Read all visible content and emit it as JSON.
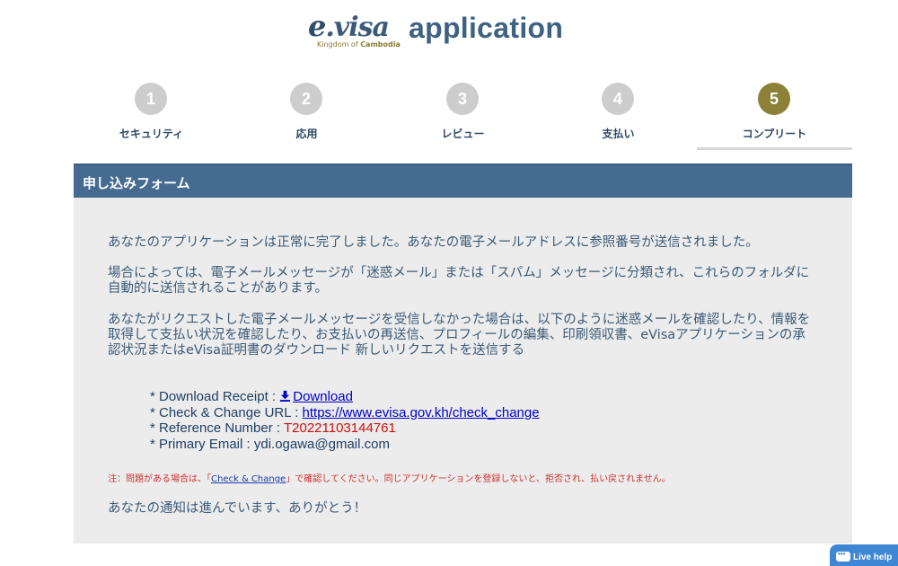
{
  "header": {
    "logo_word_e": "e",
    "logo_word_rest": ".visa",
    "logo_sub_prefix": "Kingdom of ",
    "logo_sub_bold": "Cambodia",
    "app_title": "application"
  },
  "steps": [
    {
      "number": "1",
      "label": "セキュリティ"
    },
    {
      "number": "2",
      "label": "応用"
    },
    {
      "number": "3",
      "label": "レビュー"
    },
    {
      "number": "4",
      "label": "支払い"
    },
    {
      "number": "5",
      "label": "コンプリート"
    }
  ],
  "active_step": "5",
  "panel": {
    "title": "申し込みフォーム",
    "para1": "あなたのアプリケーションは正常に完了しました。あなたの電子メールアドレスに参照番号が送信されました。",
    "para2": "場合によっては、電子メールメッセージが「迷惑メール」または「スパム」メッセージに分類され、これらのフォルダに自動的に送信されることがあります。",
    "para3": "あなたがリクエストした電子メールメッセージを受信しなかった場合は、以下のように迷惑メールを確認したり、情報を取得して支払い状況を確認したり、お支払いの再送信、プロフィールの編集、印刷領収書、eVisaアプリケーションの承認状況またはeVisa証明書のダウンロード 新しいリクエストを送信する"
  },
  "info": {
    "receipt_label": "* Download Receipt : ",
    "receipt_link": "Download",
    "check_label": "* Check & Change URL : ",
    "check_url": "https://www.evisa.gov.kh/check_change",
    "ref_label": "* Reference Number : ",
    "ref_value": "T20221103144761",
    "email_label": "* Primary Email : ",
    "email_value": "ydi.ogawa@gmail.com"
  },
  "note": {
    "prefix": "注：問題がある場合は、「",
    "link": "Check & Change",
    "suffix": "」で確認してください。同じアプリケーションを登録しないと、拒否され、払い戻されません。"
  },
  "thanks": "あなたの通知は進んでいます、ありがとう！",
  "live_help": "Live help",
  "colors": {
    "header_bar": "#466b91",
    "active_step": "#8c8137",
    "inactive_step": "#cdcdcd",
    "panel_bg": "#ececec",
    "reference": "#cc1111",
    "note": "#d23030"
  }
}
